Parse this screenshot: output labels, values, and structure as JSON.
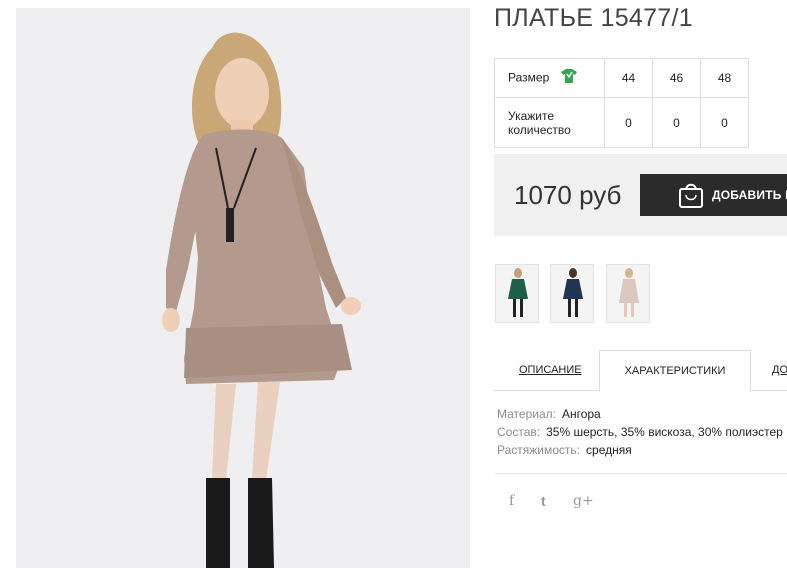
{
  "product": {
    "title": "ПЛАТЬЕ 15477/1",
    "main_image_alt": "dress-photo"
  },
  "sizes": {
    "size_label": "Размер",
    "qty_label": "Укажите количество",
    "columns": [
      "44",
      "46",
      "48"
    ],
    "quantities": [
      "0",
      "0",
      "0"
    ]
  },
  "purchase": {
    "price": "1070 руб",
    "add_label": "ДОБАВИТЬ В"
  },
  "thumbnails": [
    {
      "name": "green",
      "color": "#1f5e48"
    },
    {
      "name": "navy",
      "color": "#1f3552"
    },
    {
      "name": "beige",
      "color": "#ddc8bf"
    }
  ],
  "tabs": {
    "description": "ОПИСАНИЕ",
    "characteristics": "ХАРАКТЕРИСТИКИ",
    "more": "ДО"
  },
  "characteristics": [
    {
      "key": "Материал:",
      "value": "Ангора"
    },
    {
      "key": "Состав:",
      "value": "35% шерсть, 35% вискоза, 30% полиэстер"
    },
    {
      "key": "Растяжимость:",
      "value": "средняя"
    }
  ],
  "social": {
    "facebook": "f",
    "twitter": "t",
    "google": "g+"
  },
  "colors": {
    "accent_green": "#2ea84a",
    "button_dark": "#2b2b2b",
    "price_bg": "#f0f0f0",
    "dress": "#b39a8c"
  }
}
